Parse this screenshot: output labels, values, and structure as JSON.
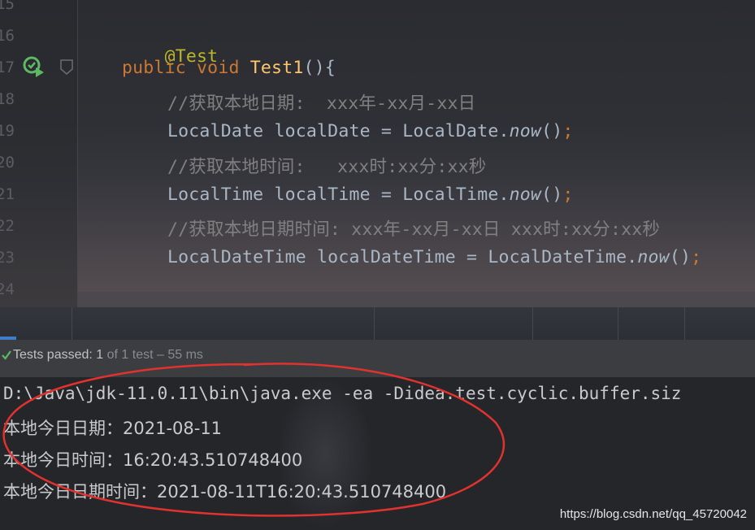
{
  "editor": {
    "line_numbers": [
      "15",
      "16",
      "17",
      "18",
      "19",
      "20",
      "21",
      "22",
      "23",
      "24"
    ],
    "lines": [
      {
        "annotation": "@Test"
      },
      {
        "kw1": "public",
        "kw2": "void",
        "name": "Test1",
        "rest": "(){"
      },
      {
        "comment": "//获取本地日期:  xxx年-xx月-xx日"
      },
      {
        "type": "LocalDate",
        "var": "localDate",
        "eq": " = ",
        "cls": "LocalDate.",
        "call": "now",
        "paren": "()",
        "semi": ";"
      },
      {
        "comment": "//获取本地时间:   xxx时:xx分:xx秒"
      },
      {
        "type": "LocalTime",
        "var": "localTime",
        "eq": " = ",
        "cls": "LocalTime.",
        "call": "now",
        "paren": "()",
        "semi": ";"
      },
      {
        "comment": "//获取本地日期时间: xxx年-xx月-xx日 xxx时:xx分:xx秒"
      },
      {
        "type": "LocalDateTime",
        "var": "localDateTime",
        "eq": " = ",
        "cls": "LocalDateTime.",
        "call": "now",
        "paren": "()",
        "semi": ";"
      }
    ]
  },
  "status": {
    "label": "Tests passed: ",
    "count": "1",
    "detail": " of 1 test – 55 ms"
  },
  "console": {
    "lines": [
      "D:\\Java\\jdk-11.0.11\\bin\\java.exe -ea -Didea.test.cyclic.buffer.siz",
      "本地今日日期：2021-08-11",
      "本地今日时间：16:20:43.510748400",
      "本地今日日期时间：2021-08-11T16:20:43.510748400"
    ]
  },
  "watermark": "https://blog.csdn.net/qq_45720042",
  "colors": {
    "annotation_ellipse": "#e0322f",
    "pass_check": "#5fb865"
  }
}
